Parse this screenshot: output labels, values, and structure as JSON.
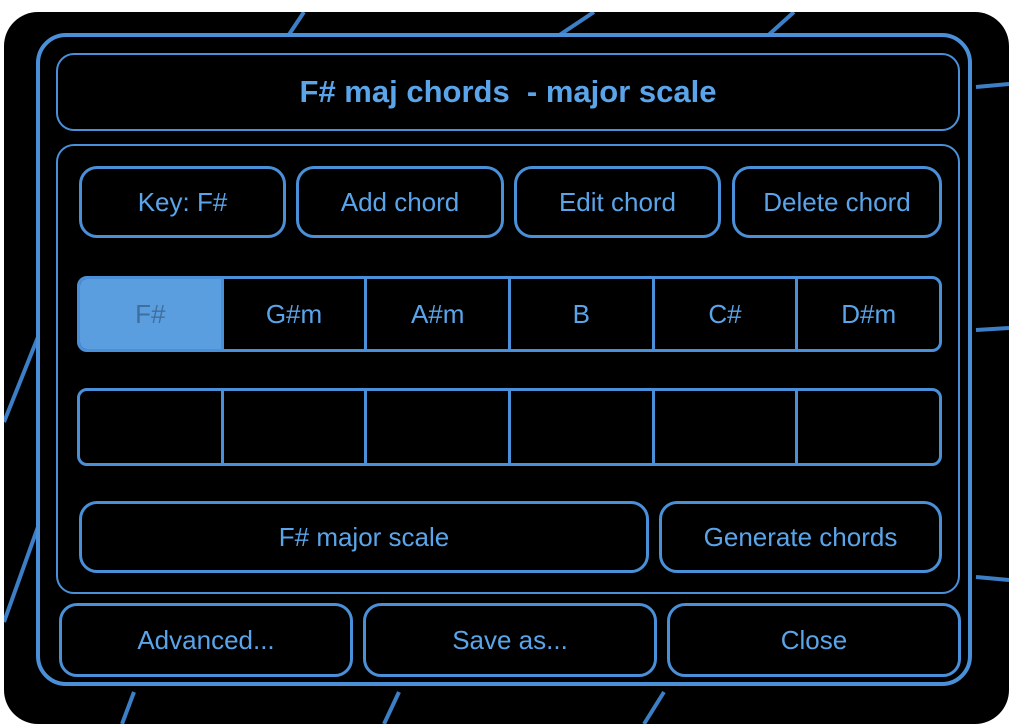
{
  "title": "F# maj chords  - major scale",
  "toolbar": {
    "key_label": "Key: F#",
    "add_label": "Add chord",
    "edit_label": "Edit chord",
    "delete_label": "Delete chord"
  },
  "chords": [
    "F#",
    "G#m",
    "A#m",
    "B",
    "C#",
    "D#m"
  ],
  "selected_chord_index": 0,
  "empty_slots": [
    "",
    "",
    "",
    "",
    "",
    ""
  ],
  "scale_label": "F# major scale",
  "generate_label": "Generate chords",
  "footer": {
    "advanced_label": "Advanced...",
    "save_label": "Save as...",
    "close_label": "Close"
  },
  "colors": {
    "accent": "#4a90d9",
    "text": "#5aa5ea",
    "selected_fill": "#5b9ee0",
    "background": "#000000"
  }
}
